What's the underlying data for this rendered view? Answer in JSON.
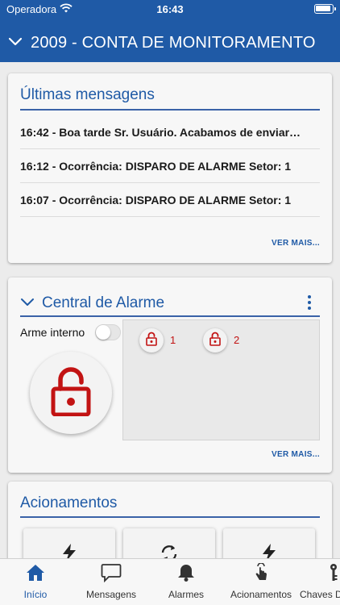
{
  "status": {
    "carrier": "Operadora",
    "time": "16:43"
  },
  "header": {
    "title": "2009 - CONTA DE MONITORAMENTO"
  },
  "messages_card": {
    "title": "Últimas mensagens",
    "items": [
      "16:42 - Boa tarde Sr. Usuário. Acabamos de enviar…",
      "16:12 - Ocorrência: DISPARO DE ALARME Setor: 1",
      "16:07 - Ocorrência: DISPARO DE ALARME Setor: 1"
    ],
    "more": "VER MAIS..."
  },
  "alarm_card": {
    "title": "Central de Alarme",
    "arme_label": "Arme interno",
    "arme_on": false,
    "zones": [
      "1",
      "2"
    ],
    "more": "VER MAIS..."
  },
  "actions_card": {
    "title": "Acionamentos"
  },
  "tabs": [
    {
      "label": "Início",
      "icon": "home-icon",
      "active": true
    },
    {
      "label": "Mensagens",
      "icon": "chat-icon",
      "active": false
    },
    {
      "label": "Alarmes",
      "icon": "bell-icon",
      "active": false
    },
    {
      "label": "Acionamentos",
      "icon": "touch-icon",
      "active": false
    },
    {
      "label": "Chaves D",
      "icon": "key-icon",
      "active": false
    }
  ],
  "colors": {
    "brand": "#1f5aa6",
    "lock": "#c21313"
  }
}
